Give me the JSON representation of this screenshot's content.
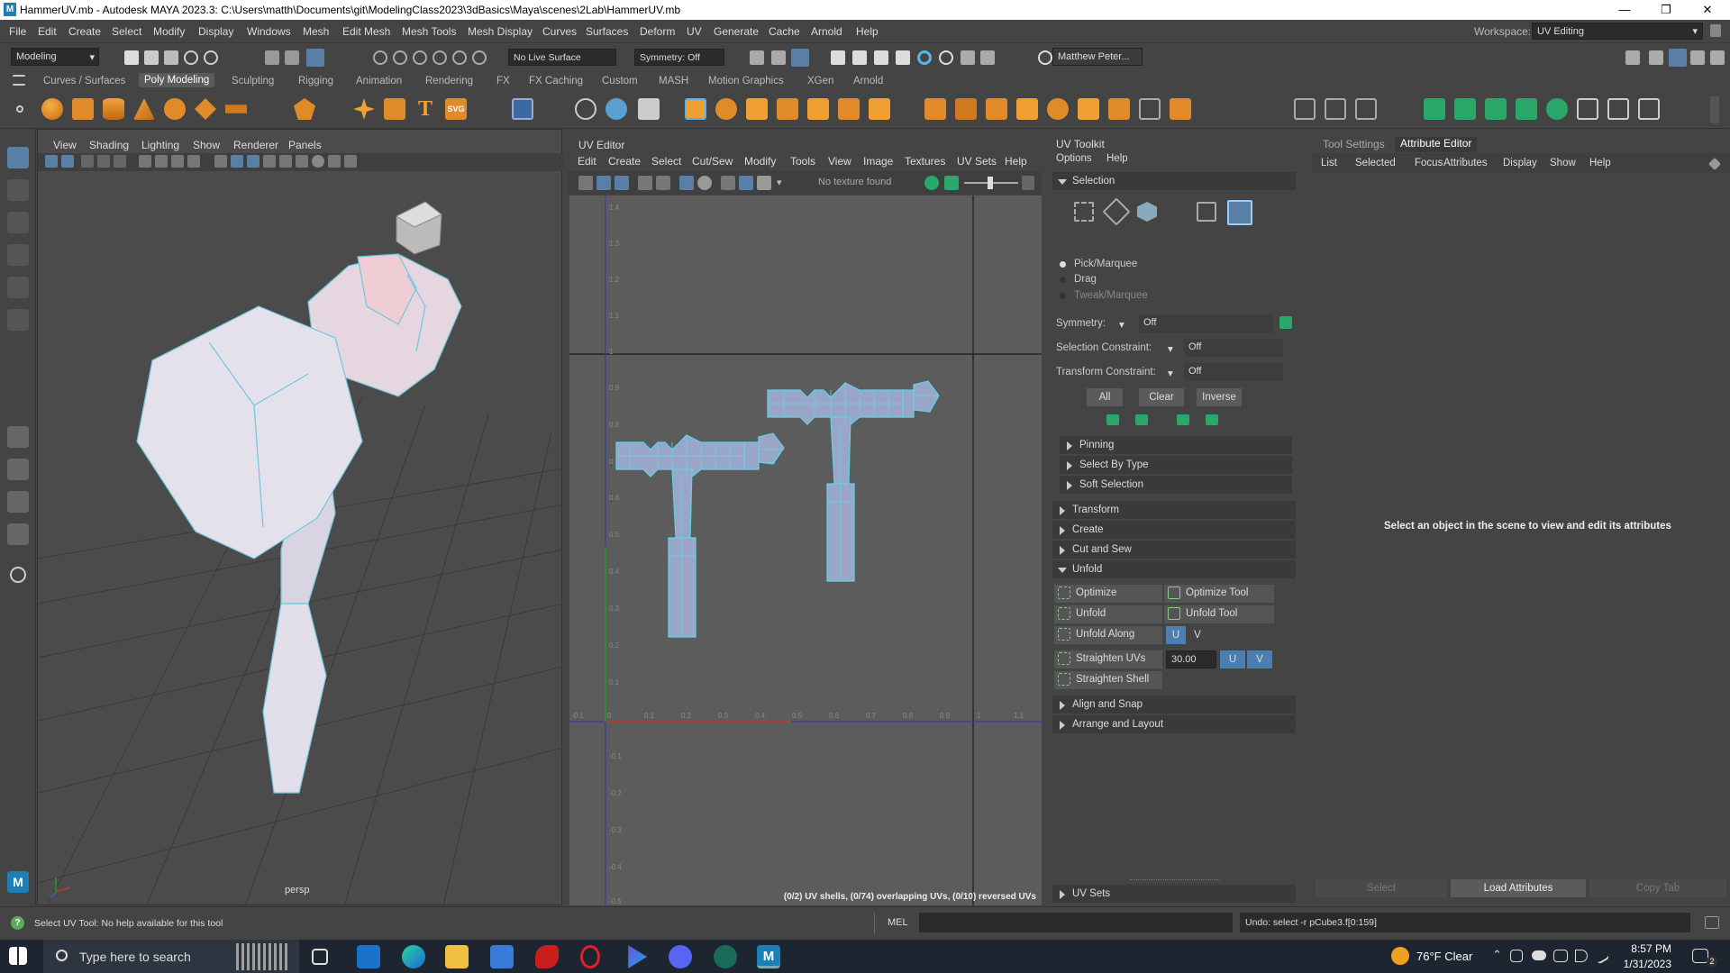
{
  "window": {
    "title": "HammerUV.mb - Autodesk MAYA 2023.3: C:\\Users\\matth\\Documents\\git\\ModelingClass2023\\3dBasics\\Maya\\scenes\\2Lab\\HammerUV.mb",
    "logo": "M"
  },
  "menubar": {
    "items": [
      "File",
      "Edit",
      "Create",
      "Select",
      "Modify",
      "Display",
      "Windows",
      "Mesh",
      "Edit Mesh",
      "Mesh Tools",
      "Mesh Display",
      "Curves",
      "Surfaces",
      "Deform",
      "UV",
      "Generate",
      "Cache",
      "Arnold",
      "Help"
    ],
    "workspace_label": "Workspace:",
    "workspace_value": "UV Editing"
  },
  "toolbar": {
    "mode": "Modeling",
    "live_surface": "No Live Surface",
    "symmetry": "Symmetry: Off",
    "user": "Matthew Peter..."
  },
  "shelf": {
    "tabs": [
      "Curves / Surfaces",
      "Poly Modeling",
      "Sculpting",
      "Rigging",
      "Animation",
      "Rendering",
      "FX",
      "FX Caching",
      "Custom",
      "MASH",
      "Motion Graphics",
      "XGen",
      "Arnold"
    ],
    "active_tab": "Poly Modeling",
    "svg_label": "SVG"
  },
  "viewport": {
    "menus": [
      "View",
      "Shading",
      "Lighting",
      "Show",
      "Renderer",
      "Panels"
    ],
    "camera": "persp"
  },
  "uv_editor": {
    "title": "UV Editor",
    "menus": [
      "Edit",
      "Create",
      "Select",
      "Cut/Sew",
      "Modify",
      "Tools",
      "View",
      "Image",
      "Textures",
      "UV Sets",
      "Help"
    ],
    "texture_status": "No texture found",
    "v_ticks": [
      "1.4",
      "1.3",
      "1.2",
      "1.1",
      "1",
      "0.9",
      "0.8",
      "0.7",
      "0.6",
      "0.5",
      "0.4",
      "0.3",
      "0.2",
      "0.1",
      "-0.1",
      "-0.2",
      "-0.3",
      "-0.4",
      "-0.5"
    ],
    "u_ticks": [
      "-0.1",
      "0",
      "0.1",
      "0.2",
      "0.3",
      "0.4",
      "0.5",
      "0.6",
      "0.7",
      "0.8",
      "0.9",
      "1",
      "1.1"
    ],
    "stats": "(0/2) UV shells, (0/74) overlapping UVs, (0/10) reversed UVs"
  },
  "uv_toolkit": {
    "title": "UV Toolkit",
    "menus": [
      "Options",
      "Help"
    ],
    "selection_header": "Selection",
    "pick_options": [
      "Pick/Marquee",
      "Drag",
      "Tweak/Marquee"
    ],
    "symmetry_label": "Symmetry:",
    "symmetry_value": "Off",
    "selection_constraint_label": "Selection Constraint:",
    "selection_constraint_value": "Off",
    "transform_constraint_label": "Transform Constraint:",
    "transform_constraint_value": "Off",
    "buttons": {
      "all": "All",
      "clear": "Clear",
      "inverse": "Inverse"
    },
    "sub_sections": [
      "Pinning",
      "Select By Type",
      "Soft Selection"
    ],
    "sections": [
      "Transform",
      "Create",
      "Cut and Sew"
    ],
    "unfold_header": "Unfold",
    "unfold": {
      "optimize": "Optimize",
      "optimize_tool": "Optimize Tool",
      "unfold": "Unfold",
      "unfold_tool": "Unfold Tool",
      "unfold_along": "Unfold Along",
      "u": "U",
      "v": "V",
      "straighten_uvs": "Straighten UVs",
      "straighten_value": "30.00",
      "straighten_shell": "Straighten Shell"
    },
    "after_sections": [
      "Align and Snap",
      "Arrange and Layout"
    ],
    "uv_sets": "UV Sets"
  },
  "attribute_editor": {
    "tabs": [
      "Tool Settings",
      "Attribute Editor"
    ],
    "active_tab": "Attribute Editor",
    "menus": [
      "List",
      "Selected",
      "Focus",
      "Attributes",
      "Display",
      "Show",
      "Help"
    ],
    "message": "Select an object in the scene to view and edit its attributes",
    "bottom_buttons": [
      "Select",
      "Load Attributes",
      "Copy Tab"
    ]
  },
  "helpline": {
    "text": "Select UV Tool: No help available for this tool",
    "mel": "MEL",
    "result": "Undo: select -r pCube3.f[0:159]"
  },
  "taskbar": {
    "search_placeholder": "Type here to search",
    "weather": "76°F  Clear",
    "time": "8:57 PM",
    "date": "1/31/2023",
    "notifications": "2"
  },
  "colors": {
    "maya_bg": "#444444",
    "uv_shell_fill": "#9aa6c8",
    "uv_shell_edge": "#5fd4e8",
    "u_axis": "#c83232",
    "v_axis": "#2a9a2a",
    "taskbar": "#1c2530"
  }
}
